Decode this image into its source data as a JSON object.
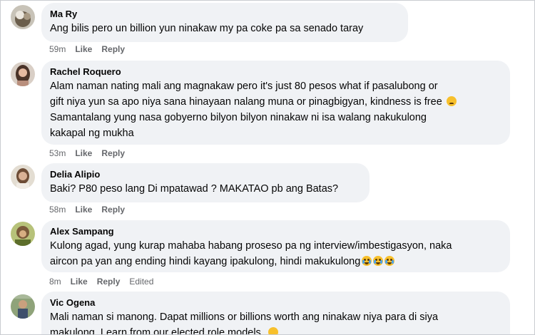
{
  "comments": [
    {
      "author": "Ma Ry",
      "lines": [
        "Ang bilis pero un billion yun ninakaw my pa coke pa sa senado taray"
      ],
      "time": "59m",
      "like": "Like",
      "reply": "Reply"
    },
    {
      "author": "Rachel Roquero",
      "lines": [
        "Alam naman nating mali ang magnakaw pero it's just 80 pesos what if pasalubong or",
        "gift niya yun sa apo niya sana hinayaan nalang muna or pinagbigyan, kindness is free",
        "Samantalang yung nasa gobyerno bilyon bilyon ninakaw ni isa walang nakukulong",
        "kakapal ng mukha"
      ],
      "time": "53m",
      "like": "Like",
      "reply": "Reply"
    },
    {
      "author": "Delia Alipio",
      "lines": [
        "Baki? P80 peso lang Di mpatawad ? MAKATAO pb ang Batas?"
      ],
      "time": "58m",
      "like": "Like",
      "reply": "Reply"
    },
    {
      "author": "Alex Sampang",
      "lines": [
        "Kulong agad, yung kurap mahaba habang proseso pa ng interview/imbestigasyon, naka",
        "aircon pa yan ang ending hindi kayang ipakulong, hindi makukulong"
      ],
      "time": "8m",
      "like": "Like",
      "reply": "Reply",
      "edited": "Edited"
    },
    {
      "author": "Vic Ogena",
      "lines": [
        "Mali naman si manong. Dapat millions or billions worth ang ninakaw niya para di siya",
        "makulong. Learn from our elected role models."
      ]
    }
  ],
  "emojis": {
    "sad_face": "sad-face-emoji",
    "laughing_crying": "face-with-tears-of-joy-emoji",
    "clapping": "clapping-hands-emoji"
  },
  "colors": {
    "bubble": "#f0f2f5",
    "meta": "#65676b",
    "text": "#050505"
  }
}
